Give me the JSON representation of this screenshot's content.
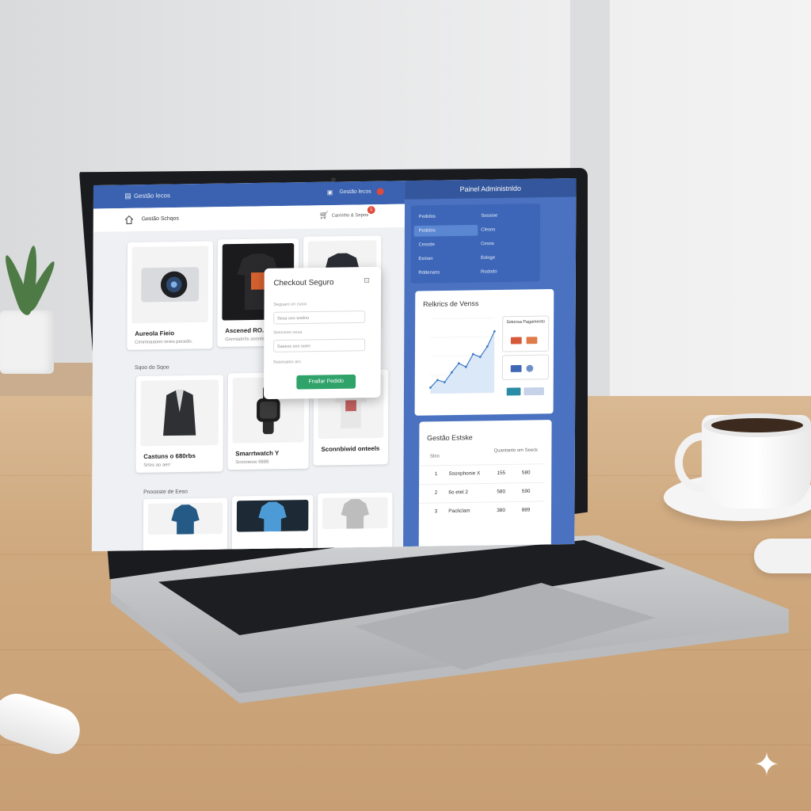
{
  "store": {
    "top_title": "Gestão lecos",
    "top_right": "Gestão lecos",
    "nav_title": "Gestão Schqos",
    "cart_label": "Carrinho & Sepos",
    "cart_count": "1",
    "products_row1": [
      {
        "name": "Aureola Fieio",
        "price": "Cenmnaaonn reres pecedo."
      },
      {
        "name": "Ascened RO.",
        "price": "Gnrmiatnhs soonts"
      },
      {
        "name": "",
        "price": ""
      }
    ],
    "section2": "Sqoo do Sqoo",
    "products_row2": [
      {
        "name": "Castuns o 680rbs",
        "price": "Srtes ao aerr"
      },
      {
        "name": "Smarrtwatch Y",
        "price": "Scoooesw 9888"
      },
      {
        "name": "Sconnbiwid onteels",
        "price": ""
      }
    ],
    "section3": "Pnoosste de Eeso"
  },
  "checkout": {
    "title": "Checkout Seguro",
    "label1": "Seguaro on cuioc",
    "field1": "Sesa oxo soelno",
    "label2": "Sescoreo ocoa",
    "field2": "Saseoo soo soeo",
    "label3": "Seseoaino aro",
    "button": "Fnallar Pedido"
  },
  "admin": {
    "title": "Painel Administnldo",
    "menu": [
      {
        "left": "Pedidos",
        "right": "Sessioe"
      },
      {
        "left": "Pedidos",
        "right": "Clesos"
      },
      {
        "left": "Cesode",
        "right": "Cesos"
      },
      {
        "left": "Esioan",
        "right": "Esloge"
      },
      {
        "left": "Rddenans",
        "right": "Rododo"
      }
    ],
    "sales_title": "Relkrics de Venss",
    "payment_title": "Sstonsa Pagamento",
    "stock_title": "Gestão Estske",
    "stock_header": "Quantanto om Seeck",
    "stock_col": "Stco",
    "stock_rows": [
      {
        "n": "1",
        "name": "Ssonphonie X",
        "a": "155",
        "b": "580"
      },
      {
        "n": "2",
        "name": "6o etel 2",
        "a": "580",
        "b": "590"
      },
      {
        "n": "3",
        "name": "Pacliclam",
        "a": "380",
        "b": "889"
      }
    ]
  },
  "chart_data": {
    "type": "line",
    "title": "Relkrics de Venss",
    "x": [
      1,
      2,
      3,
      4,
      5,
      6,
      7,
      8,
      9,
      10
    ],
    "y": [
      8,
      18,
      15,
      28,
      40,
      35,
      52,
      48,
      62,
      82
    ],
    "ylim": [
      0,
      100
    ],
    "color": "#3a78c9"
  }
}
